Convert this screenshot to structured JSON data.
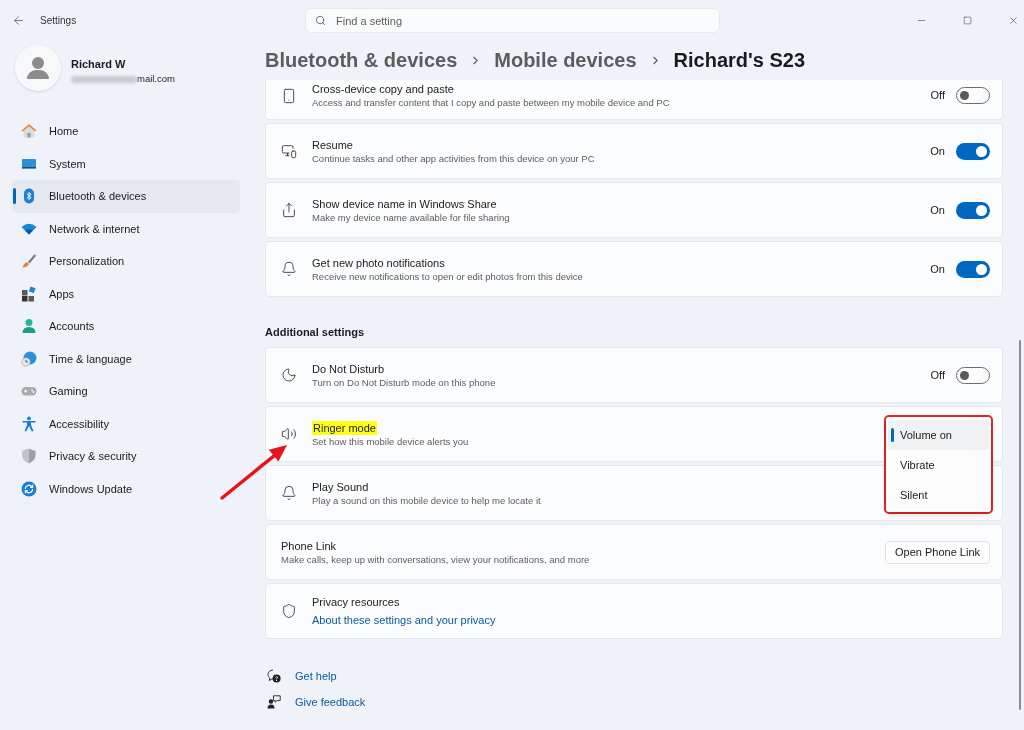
{
  "window": {
    "title": "Settings"
  },
  "search": {
    "placeholder": "Find a setting"
  },
  "user": {
    "name": "Richard W",
    "email": "mail.com"
  },
  "sidebar": {
    "items": [
      {
        "label": "Home",
        "selected": false
      },
      {
        "label": "System",
        "selected": false
      },
      {
        "label": "Bluetooth & devices",
        "selected": true
      },
      {
        "label": "Network & internet",
        "selected": false
      },
      {
        "label": "Personalization",
        "selected": false
      },
      {
        "label": "Apps",
        "selected": false
      },
      {
        "label": "Accounts",
        "selected": false
      },
      {
        "label": "Time & language",
        "selected": false
      },
      {
        "label": "Gaming",
        "selected": false
      },
      {
        "label": "Accessibility",
        "selected": false
      },
      {
        "label": "Privacy & security",
        "selected": false
      },
      {
        "label": "Windows Update",
        "selected": false
      }
    ]
  },
  "breadcrumb": [
    {
      "label": "Bluetooth & devices"
    },
    {
      "label": "Mobile devices"
    },
    {
      "label": "Richard's S23"
    }
  ],
  "device_settings": [
    {
      "kind": "toggle",
      "title": "Cross-device copy and paste",
      "description": "Access and transfer content that I copy and paste between my mobile device and PC",
      "status": "Off",
      "on": false
    },
    {
      "kind": "toggle",
      "title": "Resume",
      "description": "Continue tasks and other app activities from this device on your PC",
      "status": "On",
      "on": true
    },
    {
      "kind": "toggle",
      "title": "Show device name in Windows Share",
      "description": "Make my device name available for file sharing",
      "status": "On",
      "on": true
    },
    {
      "kind": "toggle",
      "title": "Get new photo notifications",
      "description": "Receive new notifications to open or edit photos from this device",
      "status": "On",
      "on": true
    }
  ],
  "additional_settings": {
    "heading": "Additional settings",
    "items": [
      {
        "kind": "toggle",
        "title": "Do Not Disturb",
        "highlighted": false,
        "description": "Turn on Do Not Disturb mode on this phone",
        "status": "Off",
        "on": false
      },
      {
        "kind": "dropdown",
        "title": "Ringer mode",
        "highlighted": true,
        "description": "Set how this mobile device alerts you",
        "expanded": true,
        "options": [
          {
            "label": "Volume on",
            "selected": true
          },
          {
            "label": "Vibrate",
            "selected": false
          },
          {
            "label": "Silent",
            "selected": false
          }
        ]
      },
      {
        "kind": "plain",
        "title": "Play Sound",
        "highlighted": false,
        "description": "Play a sound on this mobile device to help me locate it"
      },
      {
        "kind": "button",
        "title": "Phone Link",
        "highlighted": false,
        "description": "Make calls, keep up with conversations, view your notifications, and more",
        "button": "Open Phone Link"
      },
      {
        "kind": "link",
        "title": "Privacy resources",
        "highlighted": false,
        "link": "About these settings and your privacy"
      }
    ]
  },
  "footer_links": [
    {
      "label": "Get help"
    },
    {
      "label": "Give feedback"
    }
  ]
}
